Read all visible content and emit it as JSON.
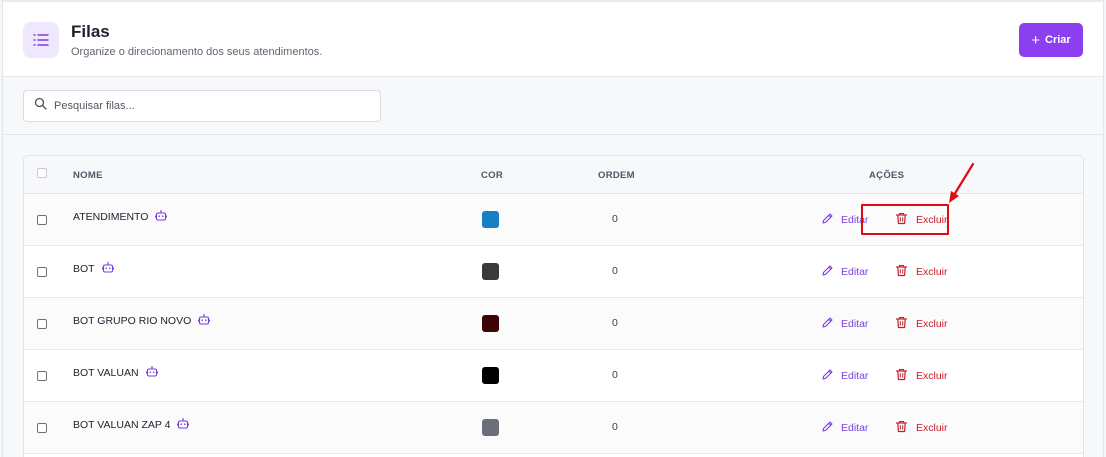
{
  "header": {
    "title": "Filas",
    "subtitle": "Organize o direcionamento dos seus atendimentos.",
    "create_label": "Criar"
  },
  "search": {
    "placeholder": "Pesquisar filas..."
  },
  "table": {
    "columns": {
      "name": "NOME",
      "color": "COR",
      "order": "ORDEM",
      "actions": "AÇÕES"
    },
    "edit_label": "Editar",
    "delete_label": "Excluir",
    "rows": [
      {
        "name": "ATENDIMENTO",
        "color": "#1680c2",
        "order": "0"
      },
      {
        "name": "BOT",
        "color": "#3a3a3a",
        "order": "0"
      },
      {
        "name": "BOT GRUPO RIO NOVO",
        "color": "#3c0608",
        "order": "0"
      },
      {
        "name": "BOT VALUAN",
        "color": "#000000",
        "order": "0"
      },
      {
        "name": "BOT VALUAN ZAP 4",
        "color": "#6b6f78",
        "order": "0"
      }
    ]
  },
  "colors": {
    "accent": "#8b3ff0",
    "edit": "#7b3fe0",
    "delete": "#c81e2a",
    "annotation": "#e00a12"
  }
}
